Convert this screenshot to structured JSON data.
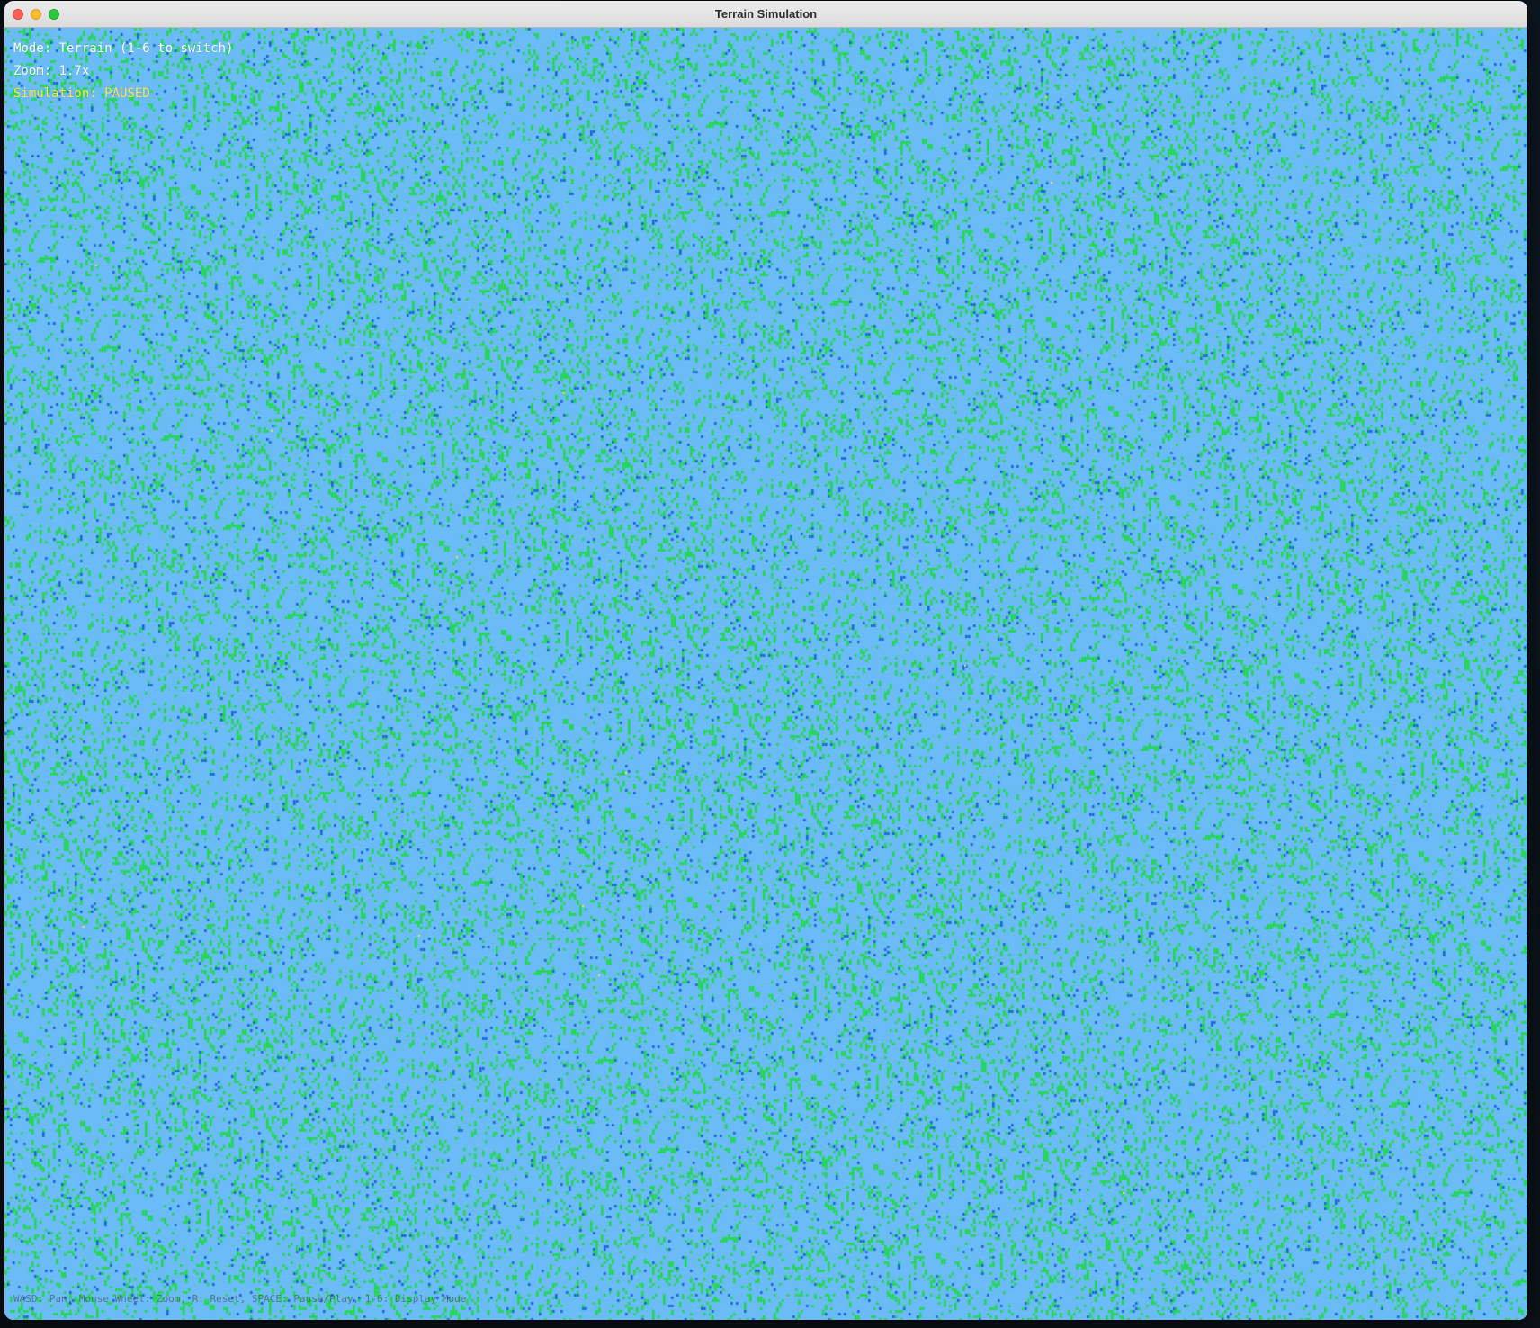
{
  "window": {
    "title": "Terrain Simulation"
  },
  "hud": {
    "mode": "Mode: Terrain (1-6 to switch)",
    "zoom": "Zoom: 1.7x",
    "simulation": "Simulation: PAUSED",
    "help": "WASD: Pan, Mouse Wheel: Zoom, R: Reset, SPACE: Pause/Play, 1-6: Display Mode"
  },
  "colors": {
    "water": "#6bbbf6",
    "grass": "#1fd94a",
    "deep_water": "#1a66d6",
    "sand": "#f2e64a",
    "hud_text": "#ffffff",
    "status_text": "#ffe94a"
  },
  "icons": {
    "close": "close-icon",
    "minimize": "minimize-icon",
    "maximize": "maximize-icon"
  }
}
